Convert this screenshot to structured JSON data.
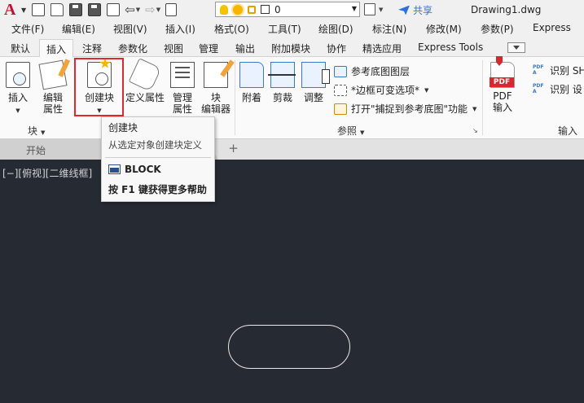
{
  "titlebar": {
    "logo": "A",
    "layer_value": "0",
    "share_label": "共享",
    "document_title": "Drawing1.dwg"
  },
  "menubar": {
    "items": [
      "文件(F)",
      "编辑(E)",
      "视图(V)",
      "插入(I)",
      "格式(O)",
      "工具(T)",
      "绘图(D)",
      "标注(N)",
      "修改(M)",
      "参数(P)",
      "Express"
    ]
  },
  "ribbon_tabs": {
    "items": [
      "默认",
      "插入",
      "注释",
      "参数化",
      "视图",
      "管理",
      "输出",
      "附加模块",
      "协作",
      "精选应用",
      "Express Tools"
    ],
    "active": "插入"
  },
  "ribbon": {
    "block_panel": {
      "insert_label": "插入",
      "edit_attr_label_1": "编辑",
      "edit_attr_label_2": "属性",
      "create_block_label": "创建块",
      "define_attr_label": "定义属性",
      "manage_label_1": "管理",
      "manage_label_2": "属性",
      "block_editor_label_1": "块",
      "block_editor_label_2": "编辑器",
      "panel_label": "块"
    },
    "reference_panel": {
      "attach_label": "附着",
      "clip_label": "剪裁",
      "adjust_label": "调整",
      "underlay_layers_label": "参考底图图层",
      "frame_label": "*边框可变选项*",
      "snap_label": "打开\"捕捉到参考底图\"功能",
      "panel_label": "参照"
    },
    "import_panel": {
      "pdf_badge": "PDF",
      "pdf_import_label_1": "PDF",
      "pdf_import_label_2": "输入",
      "recognize_shx_label": "识别 SH",
      "recognize_settings_label": "识别 设",
      "panel_label": "输入"
    }
  },
  "filetabs": {
    "start_tab_label": "开始",
    "add_tab_symbol": "+"
  },
  "viewport": {
    "view_label": "[−][俯视][二维线框]"
  },
  "tooltip": {
    "title": "创建块",
    "description": "从选定对象创建块定义",
    "command": "BLOCK",
    "help_text": "按 F1 键获得更多帮助"
  },
  "colors": {
    "viewport_bg": "#262b33",
    "highlight_border": "#e0292e",
    "share_blue": "#2f6fdc",
    "active_tab_underline": "#4a8fe0"
  }
}
